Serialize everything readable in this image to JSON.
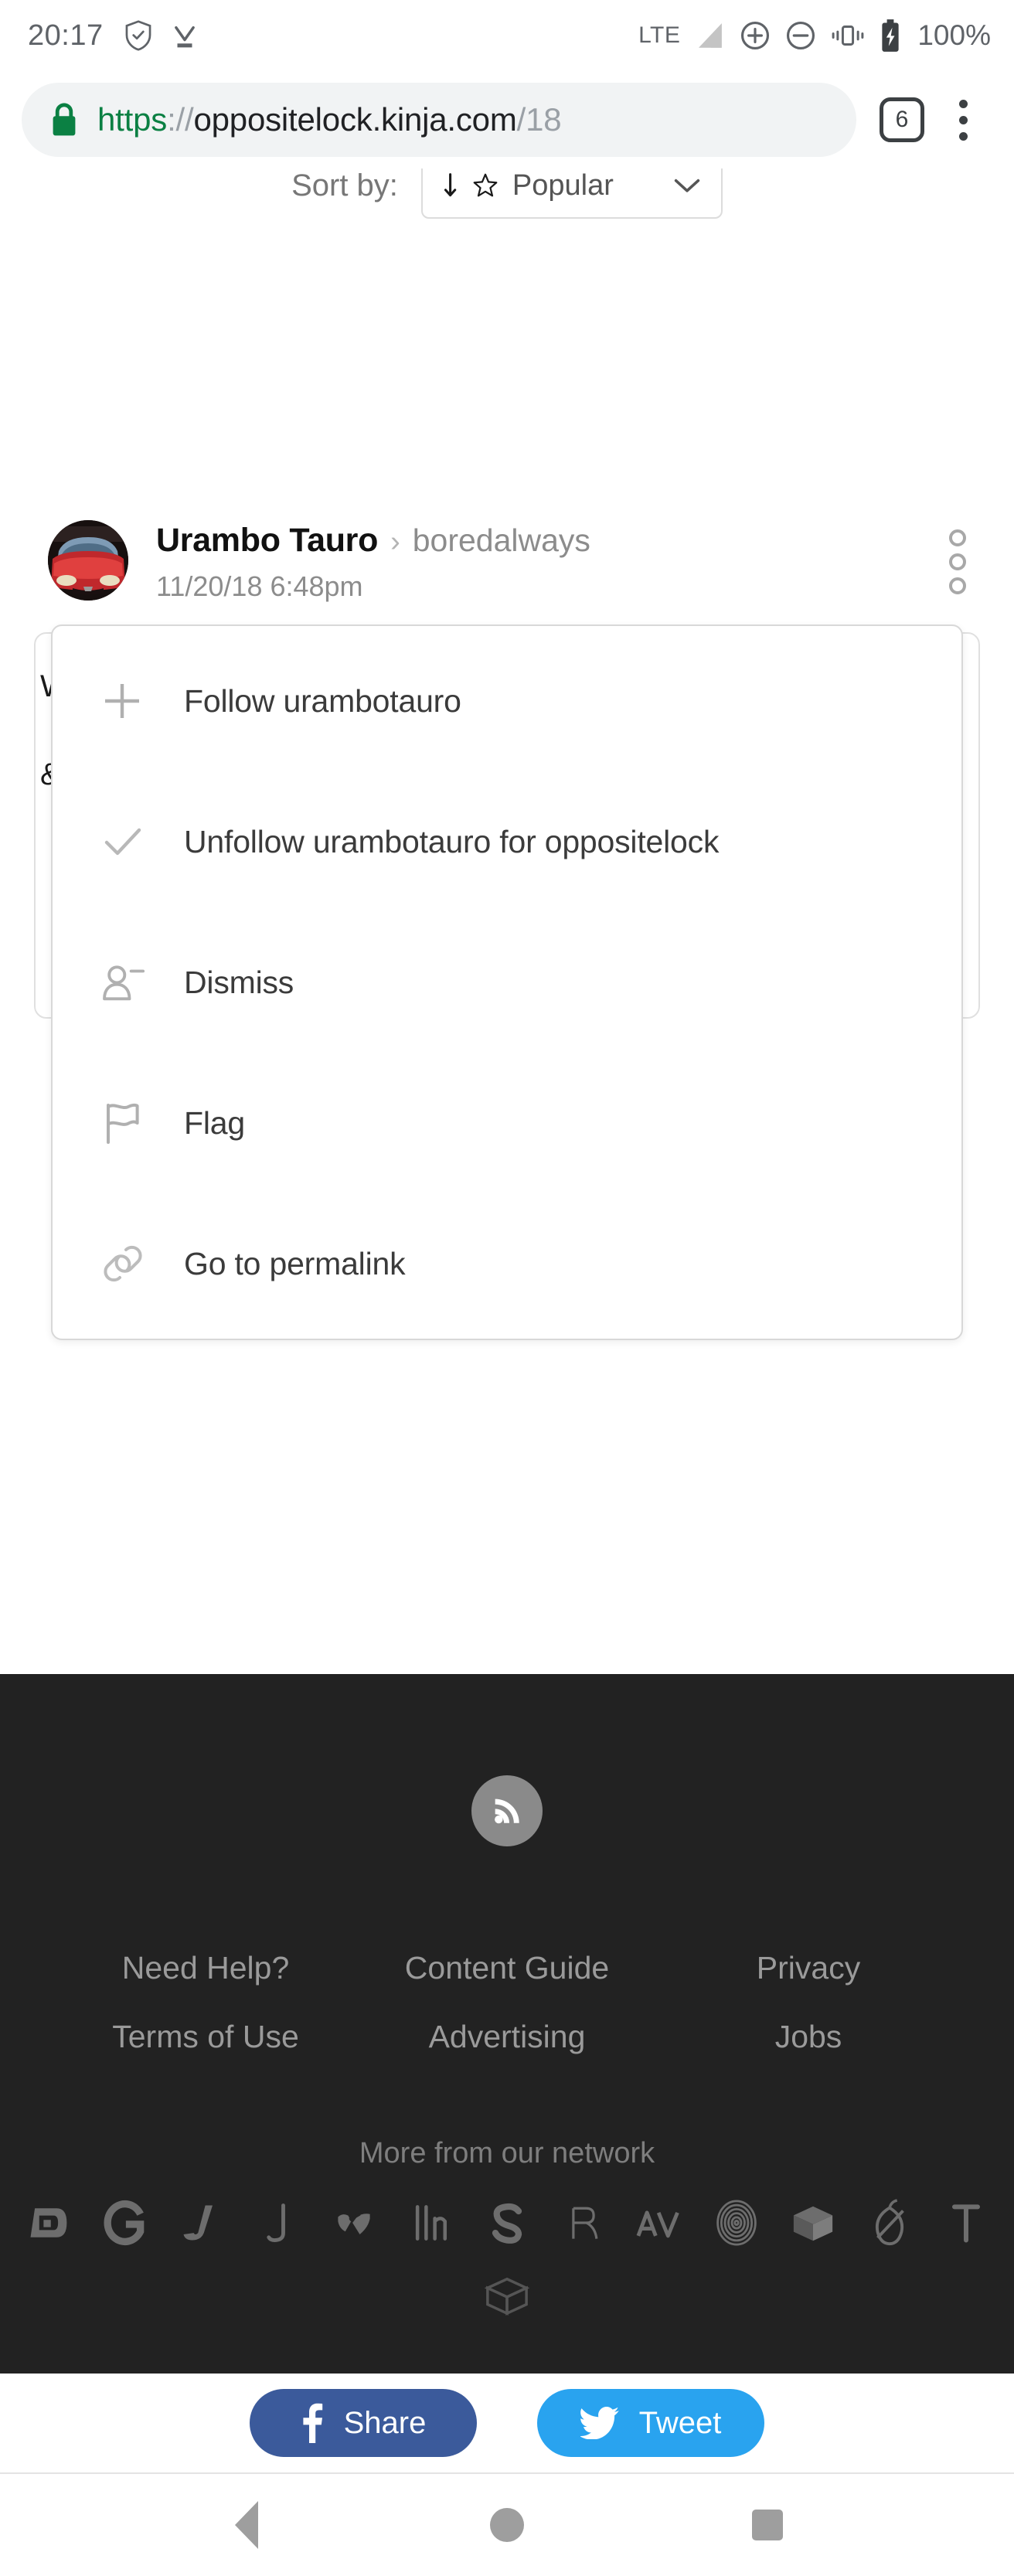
{
  "status_bar": {
    "time": "20:17",
    "network_label": "LTE",
    "battery_percent": "100%",
    "icons": [
      "shield-check-icon",
      "download-complete-icon",
      "signal-bars-icon",
      "add-circle-icon",
      "do-not-disturb-icon",
      "vibrate-icon",
      "battery-charging-icon"
    ]
  },
  "browser": {
    "url_scheme": "https",
    "url_separator": "://",
    "url_host": "oppositelock.kinja.com",
    "url_path": "/18",
    "tab_count": "6",
    "lock_color": "#0b8043"
  },
  "page": {
    "sort": {
      "label": "Sort by:",
      "sort_icon": "sort-descending-icon",
      "star_icon": "star-icon",
      "value": "Popular",
      "chevron": "chevron-down-icon"
    },
    "comment": {
      "author": "Urambo Tauro",
      "separator": "›",
      "blog": "boredalways",
      "timestamp": "11/20/18 6:48pm",
      "avatar_alt": "red-sports-car-avatar",
      "more_menu_icon": "three-dots-vertical-icon"
    },
    "menu": {
      "items": [
        {
          "label": "Follow urambotauro",
          "icon": "plus-icon"
        },
        {
          "label": "Unfollow urambotauro for oppositelock",
          "icon": "check-icon"
        },
        {
          "label": "Dismiss",
          "icon": "user-minus-icon"
        },
        {
          "label": "Flag",
          "icon": "flag-icon"
        },
        {
          "label": "Go to permalink",
          "icon": "link-chain-icon"
        }
      ]
    }
  },
  "footer": {
    "rss_icon": "rss-icon",
    "links_row1": [
      "Need Help?",
      "Content Guide",
      "Privacy"
    ],
    "links_row2": [
      "Terms of Use",
      "Advertising",
      "Jobs"
    ],
    "network_title": "More from our network",
    "network_logos": [
      "deadspin-logo",
      "gizmodo-logo",
      "jalopnik-logo",
      "jezebel-logo",
      "kotaku-logo",
      "lifehacker-logo",
      "splinter-logo",
      "the-root-logo",
      "av-club-logo",
      "clickhole-logo",
      "the-inventory-logo",
      "the-onion-logo",
      "the-takeout-logo"
    ],
    "network_logos_row2": [
      "the-inventory-logo"
    ],
    "background_color": "#222222"
  },
  "share_bar": {
    "facebook": {
      "label": "Share",
      "icon": "facebook-icon",
      "color": "#3b5a9b"
    },
    "twitter": {
      "label": "Tweet",
      "icon": "twitter-bird-icon",
      "color": "#29a3ef"
    }
  },
  "nav_bar": {
    "back": "back-triangle-icon",
    "home": "home-circle-icon",
    "recents": "recents-square-icon"
  }
}
